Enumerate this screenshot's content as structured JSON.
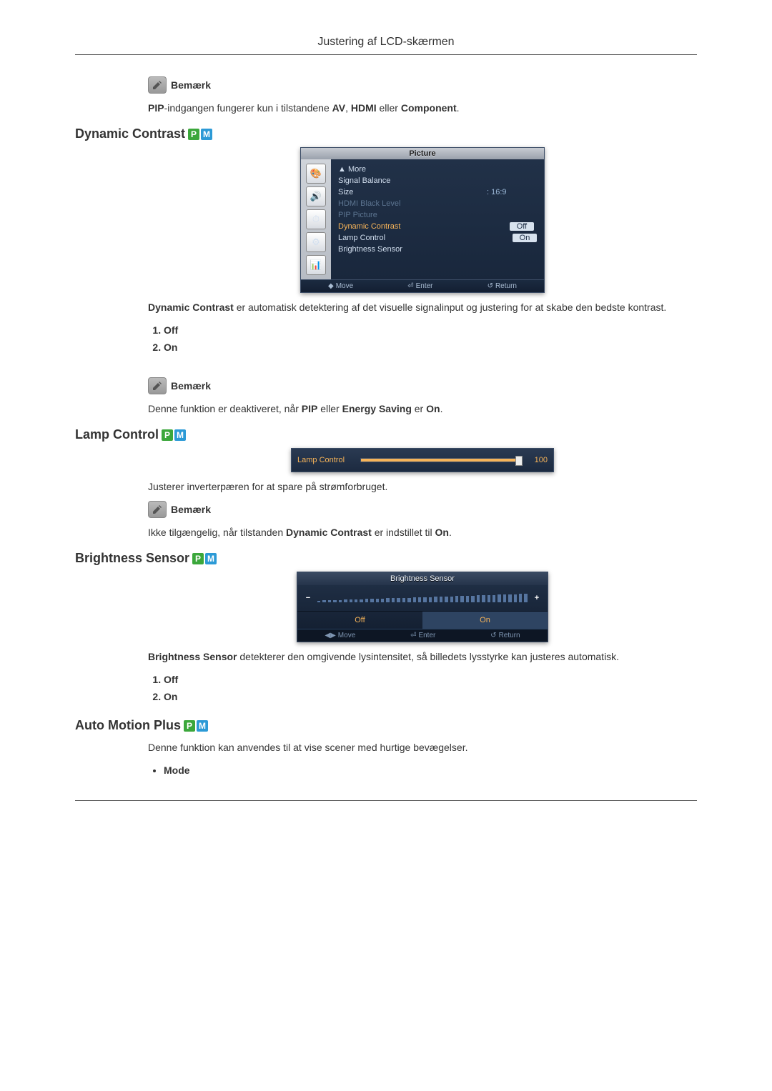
{
  "page_title": "Justering af LCD-skærmen",
  "note_label": "Bemærk",
  "sections": {
    "intro_note": "PIP-indgangen fungerer kun i tilstandene AV, HDMI eller Component.",
    "dynamic_contrast": {
      "heading": "Dynamic Contrast",
      "osd_title": "Picture",
      "osd_items": {
        "more": "▲ More",
        "signal_balance": "Signal Balance",
        "size": "Size",
        "size_val": ": 16:9",
        "hdmi_black": "HDMI Black Level",
        "pip_picture": "PIP Picture",
        "dynamic_contrast": "Dynamic Contrast",
        "dynamic_contrast_val": "Off",
        "lamp_control": "Lamp Control",
        "lamp_control_val": "On",
        "brightness_sensor": "Brightness Sensor"
      },
      "osd_footer": {
        "move": "Move",
        "enter": "Enter",
        "return": "Return"
      },
      "description": "Dynamic Contrast er automatisk detektering af det visuelle signalinput og justering for at skabe den bedste kontrast.",
      "options": [
        "Off",
        "On"
      ],
      "note_text": "Denne funktion er deaktiveret, når PIP eller Energy Saving er On."
    },
    "lamp_control": {
      "heading": "Lamp Control",
      "osd_label": "Lamp Control",
      "osd_value": "100",
      "description": "Justerer inverterpæren for at spare på strømforbruget.",
      "note_text": "Ikke tilgængelig, når tilstanden Dynamic Contrast er indstillet til On."
    },
    "brightness_sensor": {
      "heading": "Brightness Sensor",
      "osd_title": "Brightness Sensor",
      "opt_off": "Off",
      "opt_on": "On",
      "footer": {
        "move": "Move",
        "enter": "Enter",
        "return": "Return"
      },
      "description": "Brightness Sensor detekterer den omgivende lysintensitet, så billedets lysstyrke kan justeres automatisk.",
      "options": [
        "Off",
        "On"
      ]
    },
    "auto_motion_plus": {
      "heading": "Auto Motion Plus",
      "description": "Denne funktion kan anvendes til at vise scener med hurtige bevægelser.",
      "bullet": "Mode"
    }
  },
  "badges": {
    "p": "P",
    "m": "M"
  }
}
